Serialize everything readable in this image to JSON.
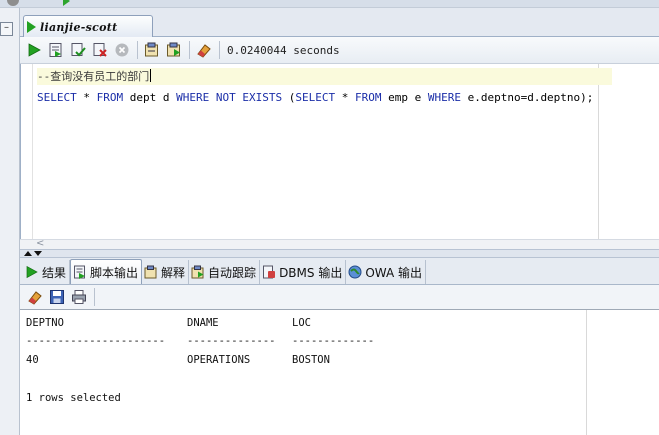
{
  "editor_tab": {
    "label": "lianjie-scott"
  },
  "toolbar": {
    "elapsed": "0.0240044 seconds"
  },
  "editor": {
    "comment": "--查询没有员工的部门",
    "sql_tokens": [
      {
        "t": "SELECT",
        "kw": true
      },
      {
        "t": " * ",
        "kw": false
      },
      {
        "t": "FROM",
        "kw": true
      },
      {
        "t": " dept d ",
        "kw": false
      },
      {
        "t": "WHERE",
        "kw": true
      },
      {
        "t": " ",
        "kw": false
      },
      {
        "t": "NOT",
        "kw": true
      },
      {
        "t": " ",
        "kw": false
      },
      {
        "t": "EXISTS",
        "kw": true
      },
      {
        "t": " (",
        "kw": false
      },
      {
        "t": "SELECT",
        "kw": true
      },
      {
        "t": " * ",
        "kw": false
      },
      {
        "t": "FROM",
        "kw": true
      },
      {
        "t": " emp e ",
        "kw": false
      },
      {
        "t": "WHERE",
        "kw": true
      },
      {
        "t": " e.deptno=d.deptno);",
        "kw": false
      }
    ],
    "hscroll_arrow": "<"
  },
  "output_tabs": [
    {
      "label": "结果",
      "icon": "play-icon"
    },
    {
      "label": "脚本输出",
      "icon": "script-output-icon",
      "active": true
    },
    {
      "label": "解释",
      "icon": "explain-plan-icon"
    },
    {
      "label": "自动跟踪",
      "icon": "autotrace-icon"
    },
    {
      "label": "DBMS 输出",
      "icon": "dbms-output-icon"
    },
    {
      "label": "OWA 输出",
      "icon": "owa-output-icon"
    }
  ],
  "result": {
    "headers": [
      "DEPTNO",
      "DNAME",
      "LOC"
    ],
    "separators": [
      "----------------------",
      "--------------",
      "-------------"
    ],
    "rows": [
      [
        "40",
        "OPERATIONS",
        "BOSTON"
      ]
    ],
    "footer": "1 rows selected"
  },
  "colors": {
    "keyword": "#1b2ea8",
    "run_green": "#22a122",
    "current_line": "#fafadc"
  }
}
